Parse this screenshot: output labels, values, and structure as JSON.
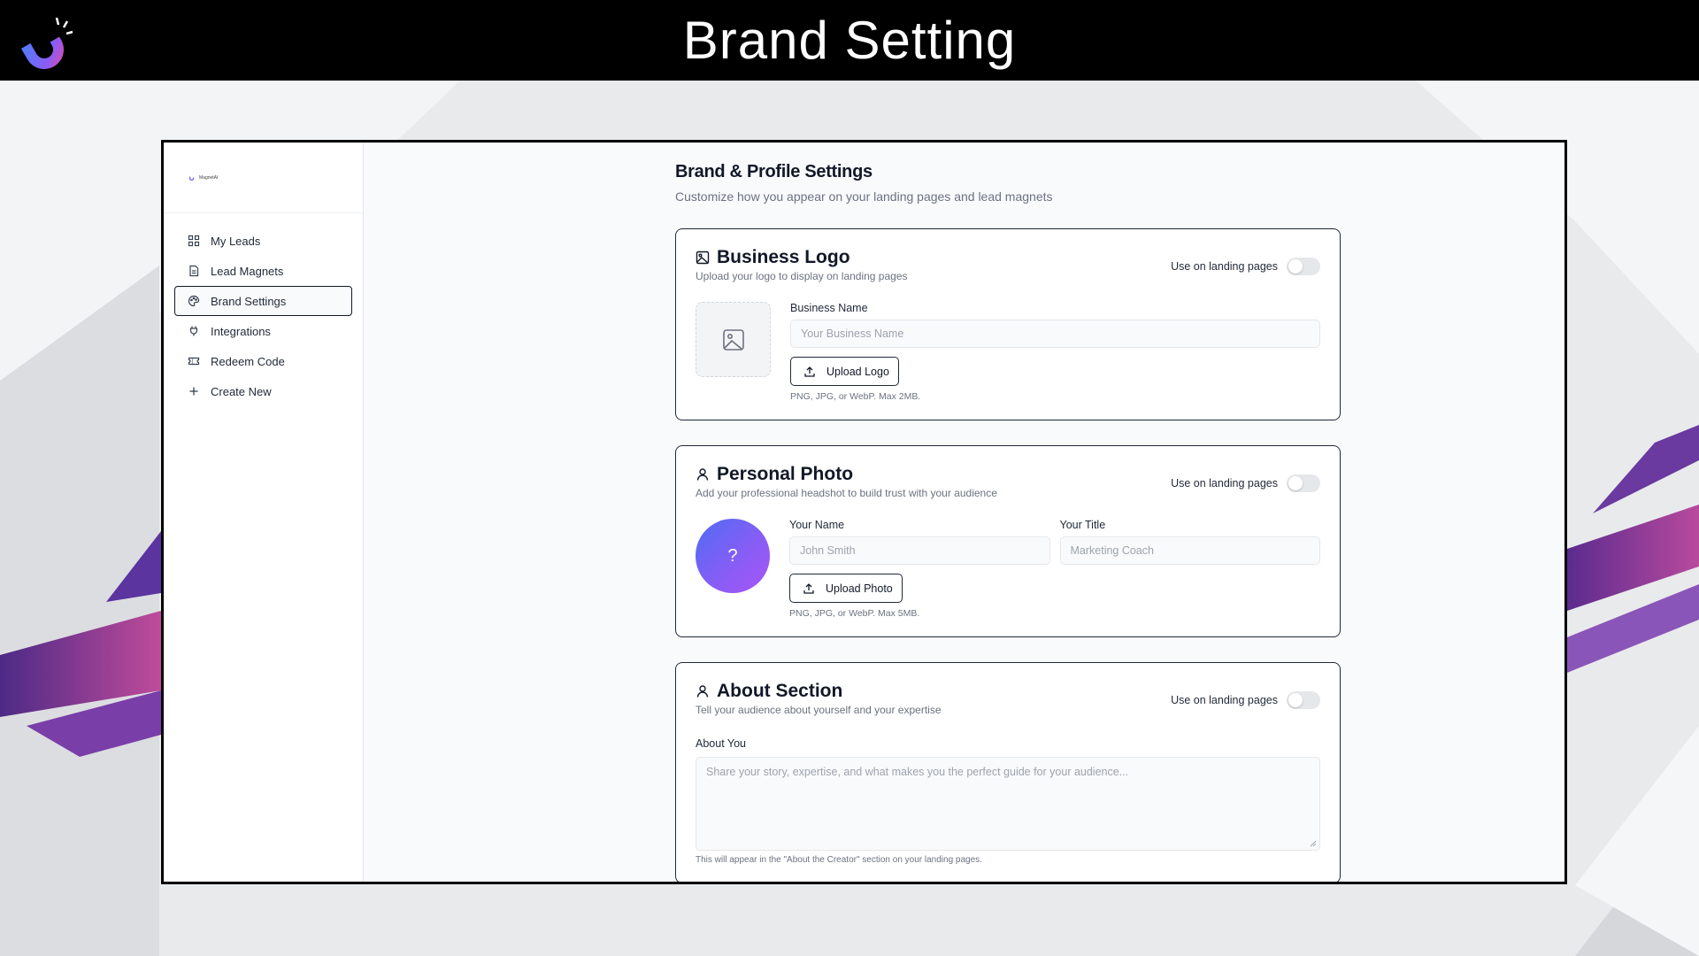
{
  "slide": {
    "title": "Brand Setting"
  },
  "sidebar": {
    "brand_text": "MagnetAI",
    "items": [
      {
        "label": "My Leads",
        "icon": "grid-icon",
        "active": false
      },
      {
        "label": "Lead Magnets",
        "icon": "document-icon",
        "active": false
      },
      {
        "label": "Brand Settings",
        "icon": "palette-icon",
        "active": true
      },
      {
        "label": "Integrations",
        "icon": "plug-icon",
        "active": false
      },
      {
        "label": "Redeem Code",
        "icon": "ticket-icon",
        "active": false
      },
      {
        "label": "Create New",
        "icon": "plus-icon",
        "active": false
      }
    ]
  },
  "header": {
    "title": "Brand & Profile Settings",
    "subtitle": "Customize how you appear on your landing pages and lead magnets"
  },
  "business_logo": {
    "title": "Business Logo",
    "subtitle": "Upload your logo to display on landing pages",
    "toggle_label": "Use on landing pages",
    "toggle_on": false,
    "name_label": "Business Name",
    "name_placeholder": "Your Business Name",
    "upload_label": "Upload Logo",
    "hint": "PNG, JPG, or WebP. Max 2MB."
  },
  "personal_photo": {
    "title": "Personal Photo",
    "subtitle": "Add your professional headshot to build trust with your audience",
    "toggle_label": "Use on landing pages",
    "toggle_on": false,
    "avatar_text": "?",
    "name_label": "Your Name",
    "name_placeholder": "John Smith",
    "title_label": "Your Title",
    "title_placeholder": "Marketing Coach",
    "upload_label": "Upload Photo",
    "hint": "PNG, JPG, or WebP. Max 5MB."
  },
  "about": {
    "title": "About Section",
    "subtitle": "Tell your audience about yourself and your expertise",
    "toggle_label": "Use on landing pages",
    "toggle_on": false,
    "label": "About You",
    "placeholder": "Share your story, expertise, and what makes you the perfect guide for your audience...",
    "hint": "This will appear in the \"About the Creator\" section on your landing pages."
  },
  "colors": {
    "topbar": "#000000",
    "accent_purple": "#7c3aed",
    "avatar_start": "#4f6cf3",
    "avatar_end": "#a855f7"
  }
}
